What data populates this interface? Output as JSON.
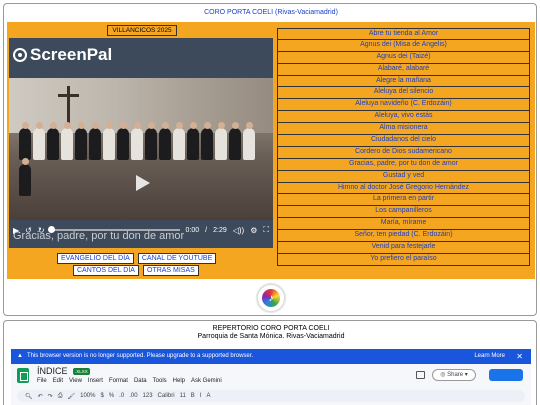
{
  "site_title": "CORO PORTA COELI (Rivas-Vaciamadrid)",
  "heading": "VILLANCICOS 2025",
  "player": {
    "logo_text": "ScreenPal",
    "current_time": "0:00",
    "separator": "/",
    "duration": "2:29",
    "progress": 0,
    "caption": "Gracias, padre, por tu don de amor",
    "icons": [
      "play-icon",
      "rewind-icon",
      "forward-icon",
      "volume-icon",
      "settings-icon",
      "fullscreen-icon"
    ]
  },
  "links_row1": [
    "EVANGELIO DEL DÍA",
    "CANAL DE YOUTUBE"
  ],
  "links_row2": [
    "CANTOS DEL DÍA",
    "OTRAS MISAS"
  ],
  "songs": [
    "Abre tu tienda al Amor",
    "Agnus dei (Misa de Angelis)",
    "Agnus dei (Taizé)",
    "Alabaré, alabaré",
    "Alegre la mañana",
    "Aleluya del silencio",
    "Aleluya navideño (C. Erdozáin)",
    "Aleluya, vivo estás",
    "Alma misionera",
    "Ciudadanos del cielo",
    "Cordero de Dios sudamericano",
    "Gracias, padre, por tu don de amor",
    "Gustad y ved",
    "Himno al doctor José Gregorio Hernández",
    "La primera en partir",
    "Los campanilleros",
    "María, mírame",
    "Señor, ten piedad (C. Erdozáin)",
    "Venid para festejarle",
    "Yo prefiero el paraíso"
  ],
  "repertoire": {
    "title": "REPERTORIO CORO PORTA COELI",
    "subtitle": "Parroquia de Santa Mónica. Rivas-Vaciamadrid"
  },
  "sheets": {
    "banner_text": "This browser version is no longer supported. Please upgrade to a supported browser.",
    "learn_more": "Learn More",
    "doc_title": "ÍNDICE",
    "badge": ".XLSX",
    "menu": [
      "File",
      "Edit",
      "View",
      "Insert",
      "Format",
      "Data",
      "Tools",
      "Help",
      "Ask Gemini"
    ],
    "share_label": "Share",
    "toolbar": [
      "100%",
      "$",
      "%",
      ".0",
      ".00",
      "123",
      "Calibri",
      "11",
      "B",
      "I",
      "A"
    ]
  },
  "colors": {
    "orange": "#f4a621",
    "link_blue": "#1a3fc7",
    "banner_blue": "#1a56db"
  }
}
